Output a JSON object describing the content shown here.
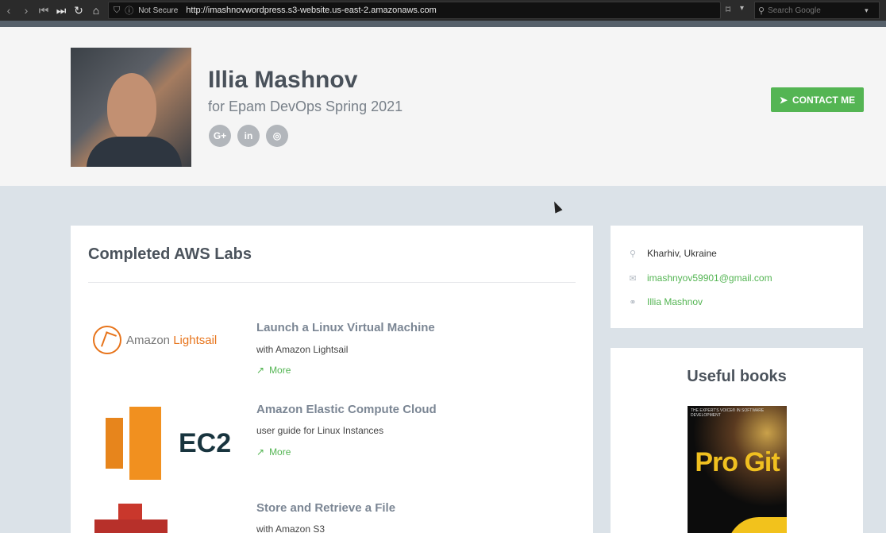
{
  "browser": {
    "security_label": "Not Secure",
    "url": "http://imashnovwordpress.s3-website.us-east-2.amazonaws.com",
    "search_placeholder": "Search Google"
  },
  "header": {
    "name": "Illia Mashnov",
    "tagline": "for Epam DevOps Spring 2021",
    "social": [
      {
        "label": "G+",
        "icon": "google-plus-icon"
      },
      {
        "label": "in",
        "icon": "linkedin-icon"
      },
      {
        "label": "◎",
        "icon": "github-icon"
      }
    ],
    "contact_label": "CONTACT ME"
  },
  "main": {
    "title": "Completed AWS Labs",
    "labs": [
      {
        "title": "Launch a Linux Virtual Machine",
        "desc": "with Amazon Lightsail",
        "more": "More",
        "logo_text_1": "Amazon",
        "logo_text_2": "Lightsail"
      },
      {
        "title": "Amazon Elastic Compute Cloud",
        "desc": "user guide for Linux Instances",
        "more": "More",
        "logo_text_1": "EC2"
      },
      {
        "title": "Store and Retrieve a File",
        "desc": "with Amazon S3"
      }
    ]
  },
  "sidebar": {
    "location": "Kharhiv, Ukraine",
    "email": "imashnyov59901@gmail.com",
    "website": "Illia Mashnov",
    "books_title": "Useful books",
    "book": {
      "title": "Pro Git",
      "top_text": "THE EXPERT'S VOICE® IN SOFTWARE DEVELOPMENT"
    }
  },
  "colors": {
    "accent": "#54b553",
    "header_bg": "#f5f5f5",
    "page_bg": "#dbe2e8"
  }
}
